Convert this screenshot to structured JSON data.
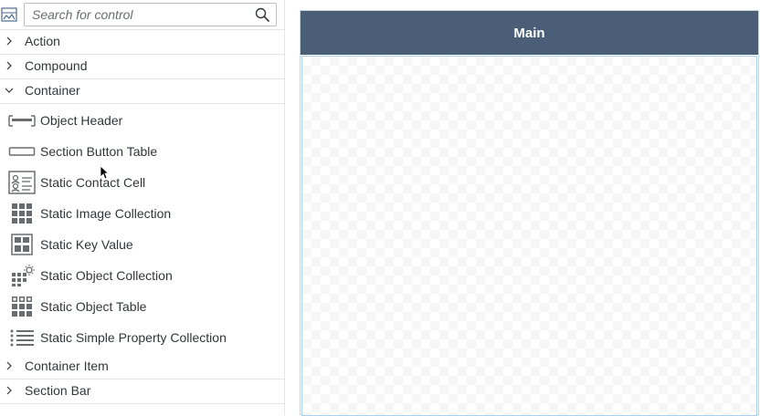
{
  "search": {
    "placeholder": "Search for control"
  },
  "groups": {
    "action": "Action",
    "compound": "Compound",
    "container": "Container",
    "container_item": "Container Item",
    "section_bar": "Section Bar"
  },
  "container_items": [
    {
      "label": "Object Header",
      "icon": "object-header-icon"
    },
    {
      "label": "Section Button Table",
      "icon": "section-button-table-icon"
    },
    {
      "label": "Static Contact Cell",
      "icon": "contact-cell-icon"
    },
    {
      "label": "Static Image Collection",
      "icon": "image-grid-icon"
    },
    {
      "label": "Static Key Value",
      "icon": "key-value-icon"
    },
    {
      "label": "Static Object Collection",
      "icon": "object-collection-icon"
    },
    {
      "label": "Static Object Table",
      "icon": "object-table-icon"
    },
    {
      "label": "Static Simple Property Collection",
      "icon": "list-icon"
    }
  ],
  "canvas": {
    "title": "Main"
  },
  "colors": {
    "header_bg": "#4a5f77",
    "icon_gray": "#6a6d70",
    "text": "#32363a",
    "selection_border": "#a9d1ef"
  }
}
